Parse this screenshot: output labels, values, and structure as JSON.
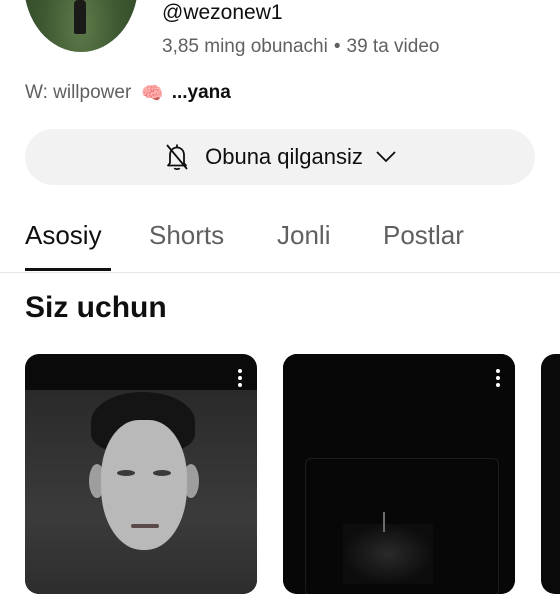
{
  "channel": {
    "handle": "@wezonew1",
    "subscribers": "3,85 ming obunachi",
    "separator": "•",
    "videos": "39 ta video",
    "description": "W: willpower",
    "description_emoji": "🧠",
    "more_label": "...yana"
  },
  "subscribe_button": {
    "label": "Obuna qilgansiz",
    "icon": "bell-off-icon",
    "dropdown_icon": "chevron-down-icon"
  },
  "tabs": [
    {
      "label": "Asosiy",
      "active": true
    },
    {
      "label": "Shorts",
      "active": false
    },
    {
      "label": "Jonli",
      "active": false
    },
    {
      "label": "Postlar",
      "active": false
    }
  ],
  "section": {
    "title": "Siz uchun"
  },
  "colors": {
    "text_primary": "#0f0f0f",
    "text_secondary": "#606060",
    "button_bg": "#f2f2f2"
  }
}
